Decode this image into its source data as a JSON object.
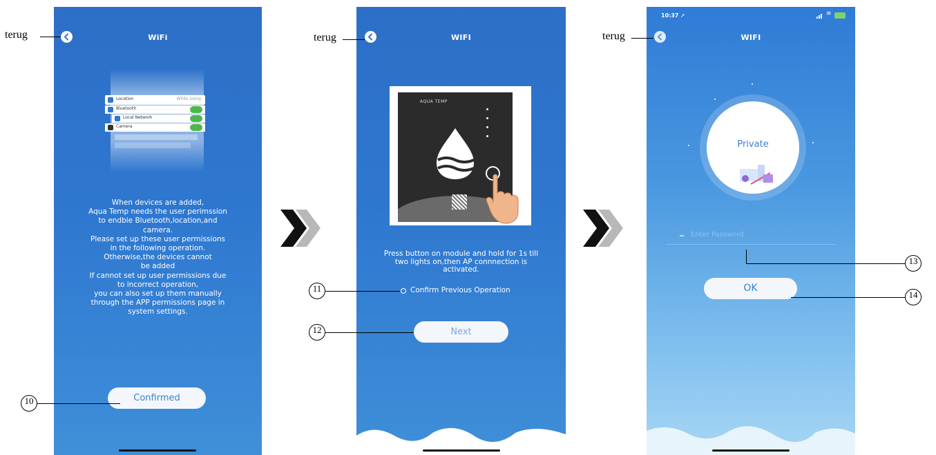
{
  "side_label": "terug",
  "screen1": {
    "title": "WiFi",
    "settings_mock": {
      "location_label": "Location",
      "location_value": "While Using",
      "bluetooth_label": "Bluetooth",
      "local_network_label": "Local Network",
      "camera_label": "Camera"
    },
    "message_lines": [
      "When devices are added‚",
      "Aqua Temp needs the user perimssion",
      "to endbie Bluetooth,location,and",
      "camera.",
      "Please set up these user permissions",
      "in the following operation.",
      "Otherwise,the devices cannot",
      "be added",
      "If cannot set up user permissions due",
      "to incorrect operation,",
      "you can also set up them manually",
      "through the APP permissions page in",
      "system settings."
    ],
    "confirm_button": "Confirmed",
    "callout": "10"
  },
  "screen2": {
    "title": "WIFI",
    "module_brand": "AQUA TEMP",
    "message_lines": [
      "Press button on module and hold for 1s till",
      "two lights on,then AP connnection is",
      "activated."
    ],
    "confirm_option": "Confirm Previous Operation",
    "next_button": "Next",
    "callout_confirm": "11",
    "callout_next": "12"
  },
  "screen3": {
    "status_time": "10:37",
    "title": "WIFI",
    "network_name": "Private",
    "password_placeholder": "Enter Password",
    "ok_button": "OK",
    "callout_password": "13",
    "callout_ok": "14"
  },
  "colors": {
    "phone_blue": "#2e77cf",
    "accent": "#3a80cf",
    "chevron_dark": "#111111",
    "chevron_light": "#b8b8b8"
  }
}
